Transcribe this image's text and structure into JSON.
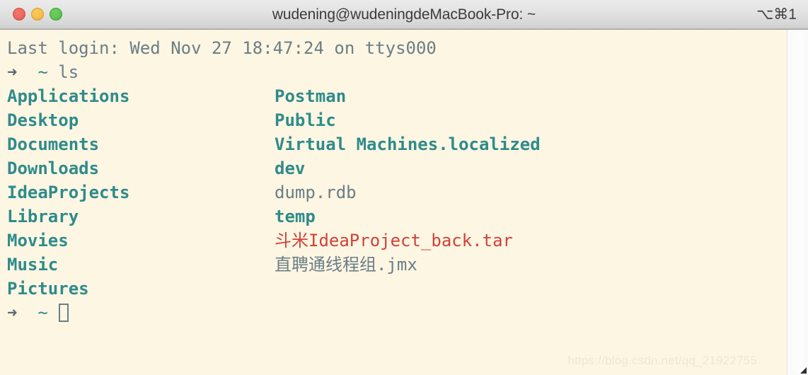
{
  "window": {
    "title": "wudening@wudeningdeMacBook-Pro: ~",
    "shortcut_label": "⌥⌘1",
    "traffic_lights": [
      {
        "name": "close",
        "color": "#ec6a5e"
      },
      {
        "name": "minimize",
        "color": "#f5bf4f"
      },
      {
        "name": "maximize",
        "color": "#61c554"
      }
    ],
    "background_color": "#fdf6e3",
    "titlebar_color": "#e2e2e2"
  },
  "colors": {
    "directory": "#2e8b8b",
    "file": "#6a7e86",
    "archive": "#cf4238",
    "prompt_arrow": "#5b6b70",
    "prompt_path": "#2e8b8b"
  },
  "terminal": {
    "login_message": "Last login: Wed Nov 27 18:47:24 on ttys000",
    "prompt": {
      "arrow": "➜",
      "path": "~"
    },
    "command": "ls",
    "listing": [
      {
        "left": {
          "text": "Applications",
          "kind": "directory"
        },
        "right": {
          "text": "Postman",
          "kind": "directory"
        }
      },
      {
        "left": {
          "text": "Desktop",
          "kind": "directory"
        },
        "right": {
          "text": "Public",
          "kind": "directory"
        }
      },
      {
        "left": {
          "text": "Documents",
          "kind": "directory"
        },
        "right": {
          "text": "Virtual Machines.localized",
          "kind": "directory"
        }
      },
      {
        "left": {
          "text": "Downloads",
          "kind": "directory"
        },
        "right": {
          "text": "dev",
          "kind": "directory"
        }
      },
      {
        "left": {
          "text": "IdeaProjects",
          "kind": "directory"
        },
        "right": {
          "text": "dump.rdb",
          "kind": "file"
        }
      },
      {
        "left": {
          "text": "Library",
          "kind": "directory"
        },
        "right": {
          "text": "temp",
          "kind": "directory"
        }
      },
      {
        "left": {
          "text": "Movies",
          "kind": "directory"
        },
        "right": {
          "text": "斗米IdeaProject_back.tar",
          "kind": "archive"
        }
      },
      {
        "left": {
          "text": "Music",
          "kind": "directory"
        },
        "right": {
          "text": "直聘通线程组.jmx",
          "kind": "file"
        }
      },
      {
        "left": {
          "text": "Pictures",
          "kind": "directory"
        },
        "right": {
          "text": "",
          "kind": "none"
        }
      }
    ],
    "cursor": "block-cursor"
  },
  "watermark": {
    "text": "https://blog.csdn.net/qq_21922755"
  }
}
